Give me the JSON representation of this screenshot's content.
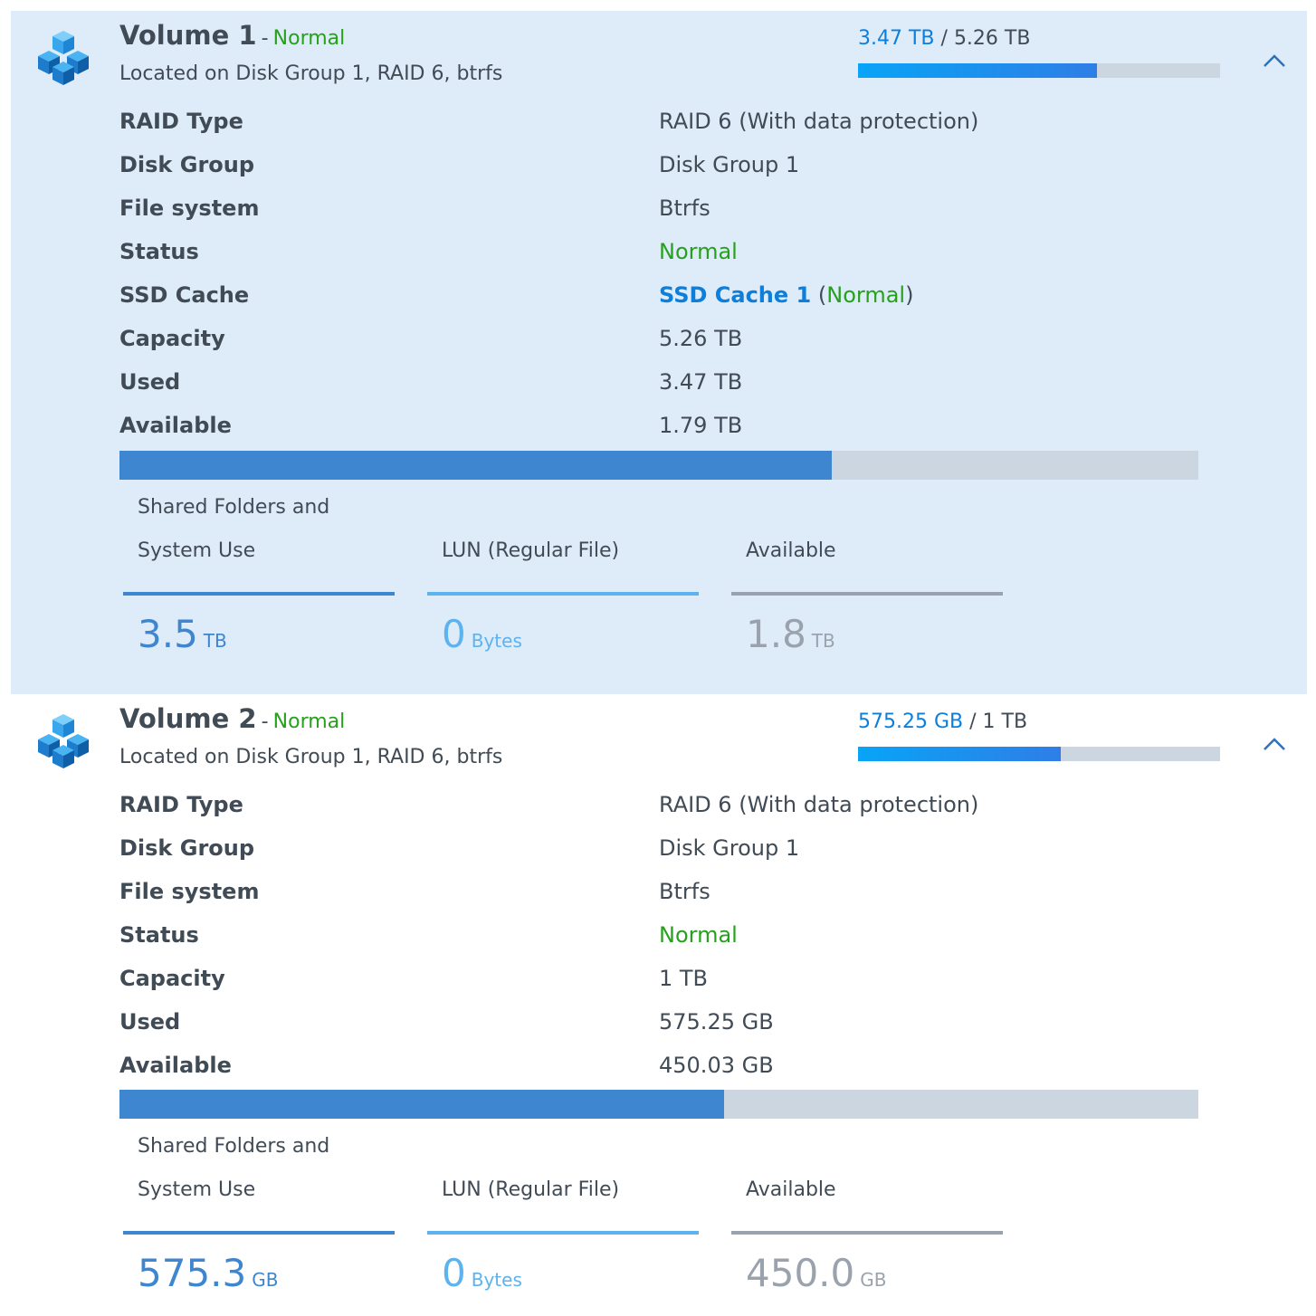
{
  "colors": {
    "accent_blue": "#0c7fdc",
    "status_green": "#26a11c",
    "bar_used": "#3e86cf",
    "bar_track": "#ccd6e0",
    "legend_shared": "#3e86cf",
    "legend_lun": "#5cb3ef",
    "legend_available": "#9aa3ad"
  },
  "volumes": [
    {
      "icon": "stacked-cubes-icon",
      "name": "Volume 1",
      "separator": "-",
      "status": "Normal",
      "location": "Located on Disk Group 1, RAID 6, btrfs",
      "usage_used": "3.47 TB",
      "usage_slash": "/",
      "usage_total": "5.26 TB",
      "usage_fraction": 0.66,
      "chevron_icon": "chevron-up-icon",
      "details": [
        {
          "label": "RAID Type",
          "value": "RAID 6 (With data protection)"
        },
        {
          "label": "Disk Group",
          "value": "Disk Group 1"
        },
        {
          "label": "File system",
          "value": "Btrfs"
        },
        {
          "label": "Status",
          "value": "Normal"
        },
        {
          "label": "SSD Cache",
          "value_link": "SSD Cache 1",
          "value_open": "(",
          "value_status": "Normal",
          "value_close": ")"
        },
        {
          "label": "Capacity",
          "value": "5.26 TB"
        },
        {
          "label": "Used",
          "value": "3.47 TB"
        },
        {
          "label": "Available",
          "value": "1.79 TB"
        }
      ],
      "capacity_fraction": 0.66,
      "legend": [
        {
          "label_line1": "Shared Folders and",
          "label_line2": "System Use",
          "value": "3.5",
          "unit": "TB"
        },
        {
          "label_line1": "",
          "label_line2": "LUN (Regular File)",
          "value": "0",
          "unit": "Bytes"
        },
        {
          "label_line1": "",
          "label_line2": "Available",
          "value": "1.8",
          "unit": "TB"
        }
      ]
    },
    {
      "icon": "stacked-cubes-icon",
      "name": "Volume 2",
      "separator": "-",
      "status": "Normal",
      "location": "Located on Disk Group 1, RAID 6, btrfs",
      "usage_used": "575.25 GB",
      "usage_slash": "/",
      "usage_total": "1 TB",
      "usage_fraction": 0.56,
      "chevron_icon": "chevron-up-icon",
      "details": [
        {
          "label": "RAID Type",
          "value": "RAID 6 (With data protection)"
        },
        {
          "label": "Disk Group",
          "value": "Disk Group 1"
        },
        {
          "label": "File system",
          "value": "Btrfs"
        },
        {
          "label": "Status",
          "value": "Normal"
        },
        {
          "label": "Capacity",
          "value": "1 TB"
        },
        {
          "label": "Used",
          "value": "575.25 GB"
        },
        {
          "label": "Available",
          "value": "450.03 GB"
        }
      ],
      "capacity_fraction": 0.56,
      "legend": [
        {
          "label_line1": "Shared Folders and",
          "label_line2": "System Use",
          "value": "575.3",
          "unit": "GB"
        },
        {
          "label_line1": "",
          "label_line2": "LUN (Regular File)",
          "value": "0",
          "unit": "Bytes"
        },
        {
          "label_line1": "",
          "label_line2": "Available",
          "value": "450.0",
          "unit": "GB"
        }
      ]
    }
  ]
}
